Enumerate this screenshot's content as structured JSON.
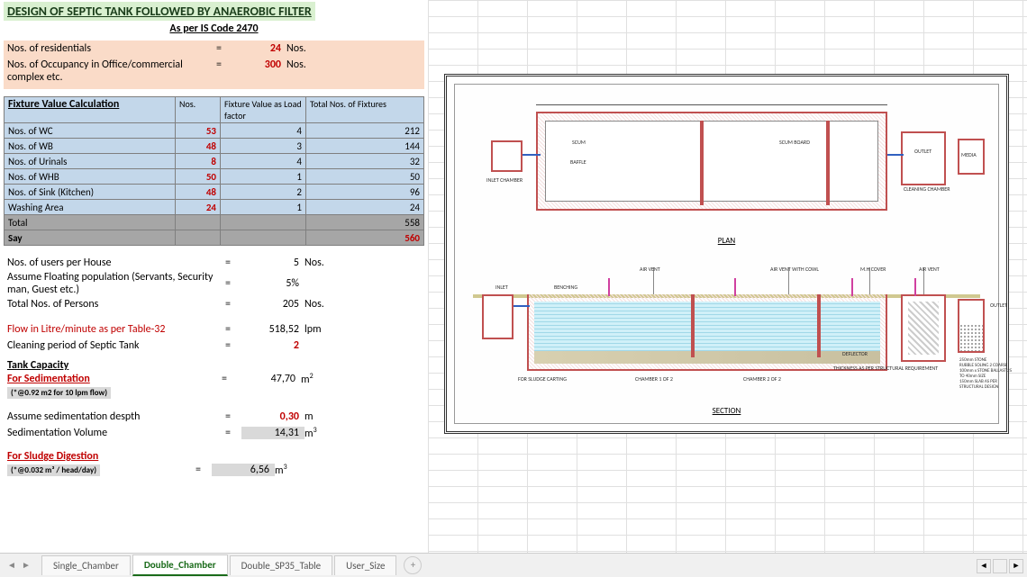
{
  "title": "DESIGN OF SEPTIC TANK FOLLOWED BY ANAEROBIC FILTER",
  "subtitle": "As per IS Code 2470",
  "inputs": {
    "residentials": {
      "label": "Nos. of residentials",
      "value": "24",
      "unit": "Nos."
    },
    "occupancy": {
      "label": "Nos. of Occupancy in Office/commercial complex etc.",
      "value": "300",
      "unit": "Nos."
    }
  },
  "fixture": {
    "header": "Fixture Value Calculation",
    "cols": [
      "Nos.",
      "Fixture Value as Load factor",
      "Total Nos. of Fixtures"
    ],
    "rows": [
      {
        "label": "Nos. of WC",
        "n": "53",
        "f": "4",
        "t": "212"
      },
      {
        "label": "Nos. of WB",
        "n": "48",
        "f": "3",
        "t": "144"
      },
      {
        "label": "Nos. of Urinals",
        "n": "8",
        "f": "4",
        "t": "32"
      },
      {
        "label": "Nos. of WHB",
        "n": "50",
        "f": "1",
        "t": "50"
      },
      {
        "label": "Nos. of Sink (Kitchen)",
        "n": "48",
        "f": "2",
        "t": "96"
      },
      {
        "label": "Washing Area",
        "n": "24",
        "f": "1",
        "t": "24"
      }
    ],
    "total": {
      "label": "Total",
      "value": "558"
    },
    "say": {
      "label": "Say",
      "value": "560"
    }
  },
  "calc": {
    "users_per_house": {
      "label": "Nos. of users per House",
      "value": "5",
      "unit": "Nos."
    },
    "floating": {
      "label": "Assume Floating population (Servants, Security man, Guest etc.)",
      "value": "5%",
      "unit": ""
    },
    "total_persons": {
      "label": "Total Nos. of Persons",
      "value": "205",
      "unit": "Nos."
    },
    "flow": {
      "label": "Flow in Litre/minute as per Table-32",
      "value": "518,52",
      "unit": "lpm"
    },
    "cleaning": {
      "label": "Cleaning period of Septic Tank",
      "value": "2",
      "unit": ""
    }
  },
  "capacity": {
    "header": "Tank Capacity",
    "sedimentation": {
      "header": "For Sedimentation",
      "note": "(*@0.92 m2 for 10 lpm flow)",
      "area": {
        "value": "47,70",
        "unit": "m²"
      },
      "depth": {
        "label": "Assume sedimentation despth",
        "value": "0,30",
        "unit": "m"
      },
      "volume": {
        "label": "Sedimentation Volume",
        "value": "14,31",
        "unit": "m³"
      }
    },
    "sludge": {
      "header": "For Sludge Digestion",
      "note": "(*@0.032 m³ / head/day)",
      "value": "6,56",
      "unit": "m³"
    }
  },
  "drawing": {
    "plan_label": "PLAN",
    "section_label": "SECTION",
    "annotations": {
      "inlet_chamber": "INLET CHAMBER",
      "baffle": "BAFFLE",
      "scum_board": "SCUM BOARD",
      "outlet": "OUTLET",
      "cleaning_chamber": "CLEANING CHAMBER",
      "media": "MEDIA"
    }
  },
  "tabs": {
    "items": [
      "Single_Chamber",
      "Double_Chamber",
      "Double_SP35_Table",
      "User_Size"
    ],
    "active": 1
  }
}
